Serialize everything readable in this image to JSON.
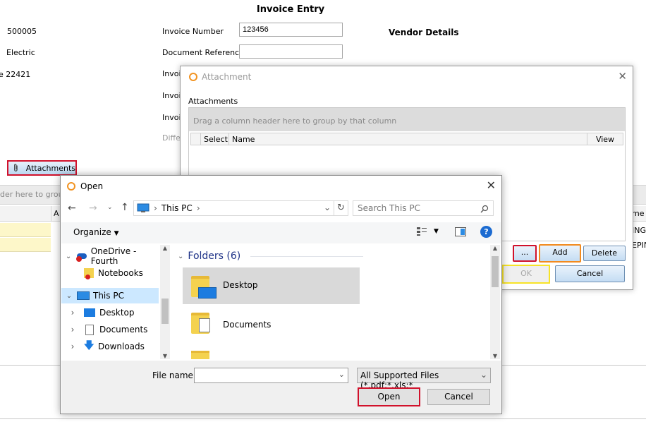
{
  "invoice": {
    "title": "Invoice Entry",
    "left_values": [
      "500005",
      "Electric",
      "e  22421"
    ],
    "labels": {
      "invoice_number": "Invoice Number",
      "document_reference": "Document Reference",
      "invoice_partial_1": "Invoi",
      "invoice_partial_2": "Invoi",
      "invoice_partial_3": "Invoi",
      "difference_partial": "Diffe"
    },
    "invoice_number_value": "123456",
    "vendor_details": "Vendor Details",
    "attachments_button": "Attachments",
    "group_hint_partial": "der here to group",
    "col_partial": "A",
    "right_col_header_partial": "me",
    "right_row_1_partial": "ING",
    "right_row_2_partial": "EPIN"
  },
  "attachment_dialog": {
    "title": "Attachment",
    "section_label": "Attachments",
    "group_hint": "Drag a column header here to group by that column",
    "columns": [
      "Select",
      "Name",
      "View"
    ],
    "buttons": {
      "browse": "...",
      "add": "Add",
      "delete": "Delete",
      "ok": "OK",
      "cancel": "Cancel"
    }
  },
  "open_dialog": {
    "title": "Open",
    "address": {
      "location": "This PC"
    },
    "search_placeholder": "Search This PC",
    "organize_label": "Organize",
    "tree": [
      {
        "label": "OneDrive - Fourth",
        "icon": "onedrive-icon"
      },
      {
        "label": "Notebooks",
        "icon": "notebook-folder-icon"
      },
      {
        "label": "This PC",
        "icon": "computer-icon",
        "selected": true
      },
      {
        "label": "Desktop",
        "icon": "desktop-icon"
      },
      {
        "label": "Documents",
        "icon": "documents-icon"
      },
      {
        "label": "Downloads",
        "icon": "downloads-icon"
      }
    ],
    "folders_header": "Folders (6)",
    "folders": [
      {
        "label": "Desktop",
        "selected": true
      },
      {
        "label": "Documents"
      }
    ],
    "file_name_label": "File name:",
    "file_name_value": "",
    "file_type": "All Supported Files (*.pdf;*.xls;*",
    "open_button": "Open",
    "cancel_button": "Cancel"
  }
}
